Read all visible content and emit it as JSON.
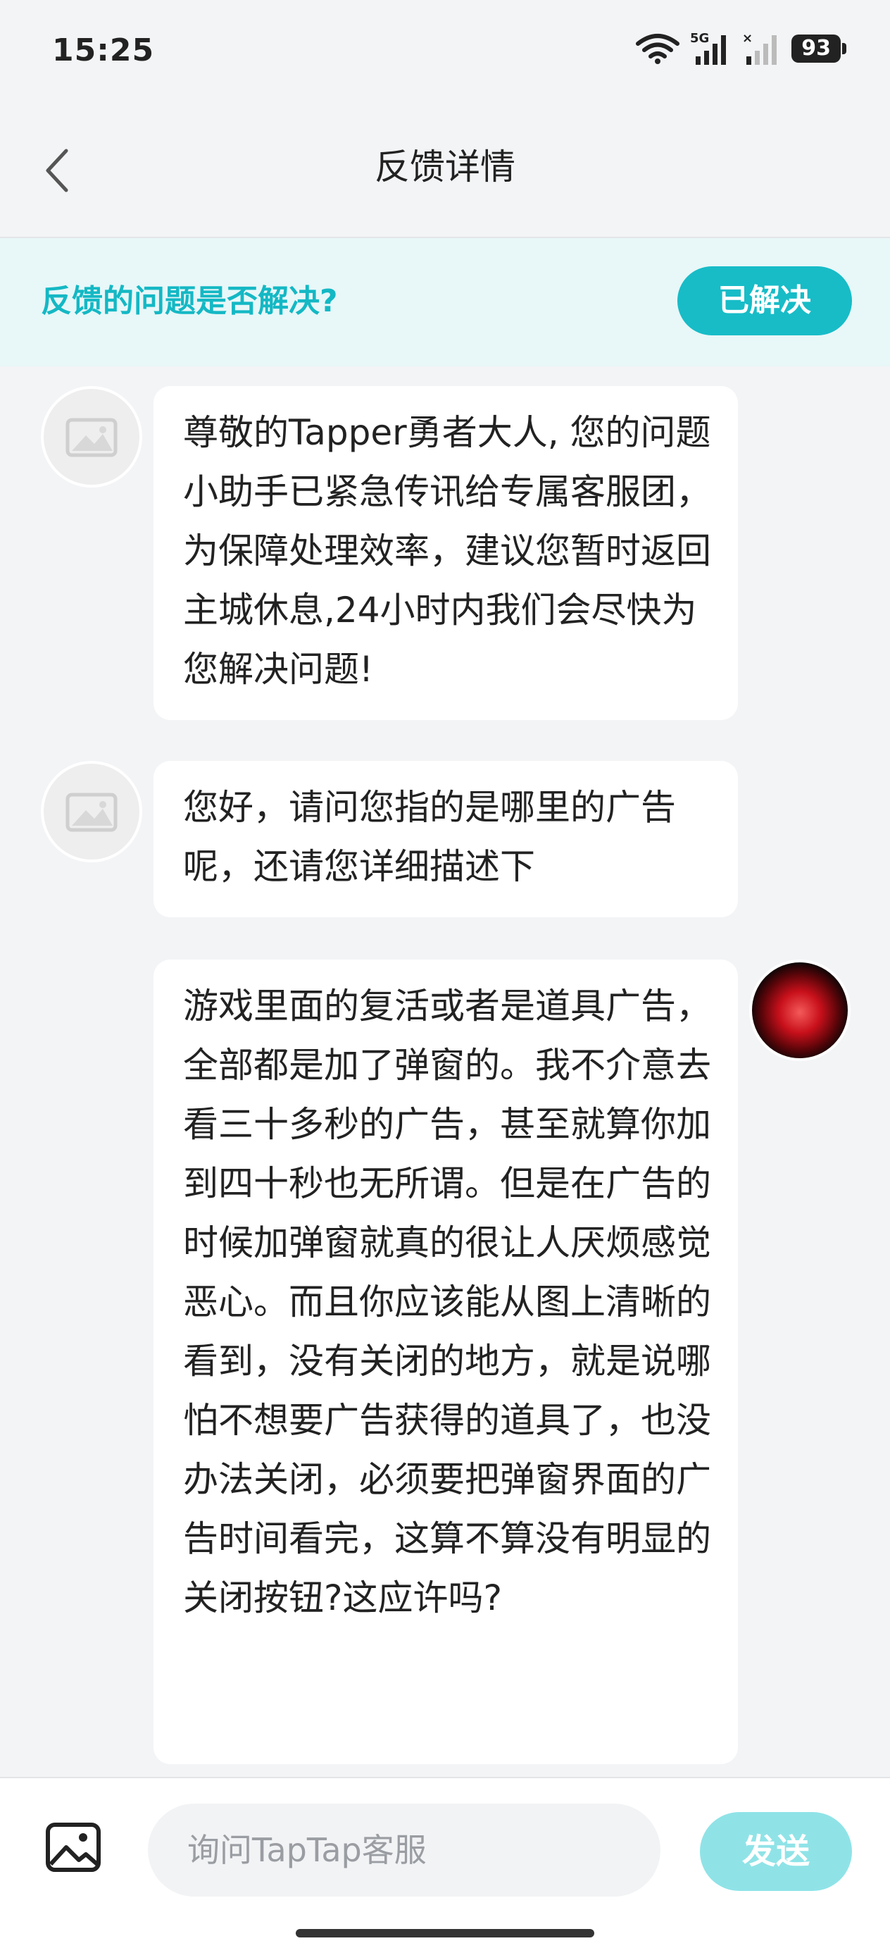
{
  "status_bar": {
    "time": "15:25",
    "network_label": "5G",
    "battery": "93"
  },
  "header": {
    "title": "反馈详情",
    "back_icon": "chevron-left-icon"
  },
  "banner": {
    "question": "反馈的问题是否解决?",
    "resolved_label": "已解决"
  },
  "messages": [
    {
      "sender": "agent",
      "text": "尊敬的Tapper勇者大人, 您的问题小助手已紧急传讯给专属客服团，为保障处理效率，建议您暂时返回主城休息,24小时内我们会尽快为您解决问题!"
    },
    {
      "sender": "agent",
      "text": "您好，请问您指的是哪里的广告呢，还请您详细描述下"
    },
    {
      "sender": "user",
      "text": "游戏里面的复活或者是道具广告，全部都是加了弹窗的。我不介意去看三十多秒的广告，甚至就算你加到四十秒也无所谓。但是在广告的时候加弹窗就真的很让人厌烦感觉恶心。而且你应该能从图上清晰的看到，没有关闭的地方，就是说哪怕不想要广告获得的道具了，也没办法关闭，必须要把弹窗界面的广告时间看完，这算不算没有明显的关闭按钮?这应许吗?"
    }
  ],
  "input_bar": {
    "placeholder": "询问TapTap客服",
    "send_label": "发送",
    "image_icon": "image-icon"
  },
  "colors": {
    "accent": "#17bcc7",
    "banner_bg": "#e8f7f8",
    "send_disabled": "#8fe3e7",
    "page_bg": "#f3f4f6"
  }
}
